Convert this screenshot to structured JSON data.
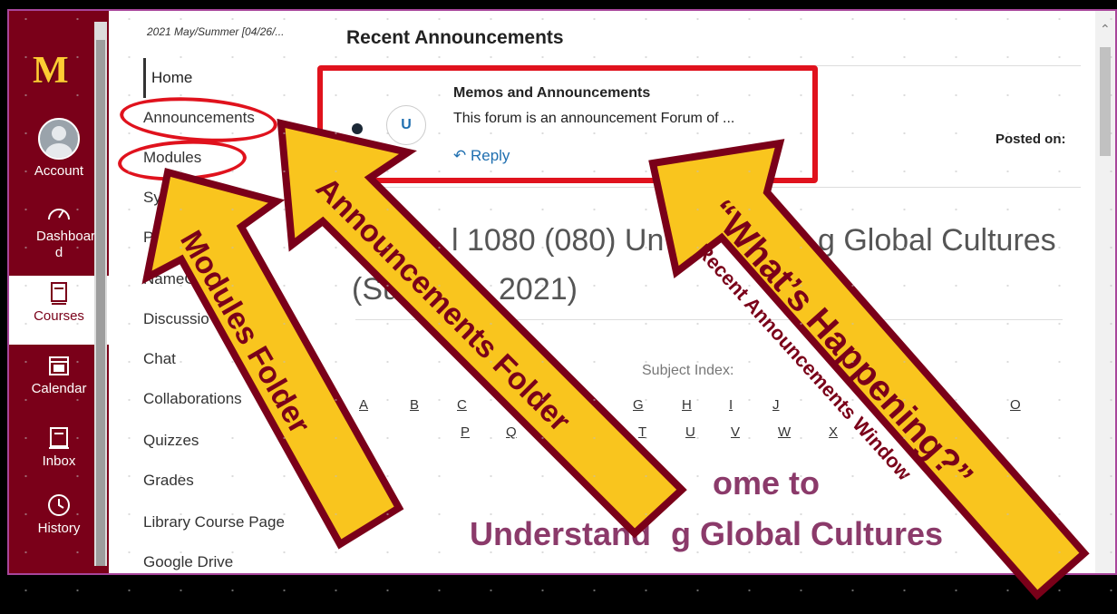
{
  "global_nav": {
    "logo": "M",
    "items": [
      {
        "label": "Account",
        "icon": "account-avatar-icon"
      },
      {
        "label": "Dashboar d",
        "icon": "dashboard-icon"
      },
      {
        "label": "Courses",
        "icon": "courses-icon"
      },
      {
        "label": "Calendar",
        "icon": "calendar-icon"
      },
      {
        "label": "Inbox",
        "icon": "inbox-icon"
      },
      {
        "label": "History",
        "icon": "history-icon"
      }
    ]
  },
  "course_nav": {
    "term": "2021 May/Summer [04/26/...",
    "items": [
      "Home",
      "Announcements",
      "Modules",
      "Sylla",
      "Peo",
      "NameC",
      "Discussio",
      "Chat",
      "Collaborations",
      "Quizzes",
      "Grades",
      "Library Course Page",
      "Google Drive"
    ]
  },
  "recent_announcements": {
    "title": "Recent Announcements",
    "avatar_letter": "U",
    "memo_title": "Memos and Announcements",
    "memo_body": "This forum is an announcement Forum of ...",
    "reply_label": "Reply",
    "posted_label": "Posted on:"
  },
  "course": {
    "title_line1": "l 1080 (080) Un",
    "title_line1b": "g Global Cultures",
    "title_line2": "(Su",
    "title_line2b": "2021)",
    "subject_index_label": "Subject Index:",
    "letters_row1": [
      "A",
      "B",
      "C",
      "G",
      "H",
      "I",
      "J",
      "O"
    ],
    "letters_row2": [
      "P",
      "Q",
      "T",
      "U",
      "V",
      "W",
      "X"
    ],
    "welcome_line1": "ome to",
    "welcome_line2a": "Understand",
    "welcome_line2b": "g Global Cultures"
  },
  "annotations": {
    "modules_label": "Modules Folder",
    "announcements_label": "Announcements Folder",
    "whats_happening": "“What’s Happening?”",
    "recent_window": "Recent Announcements Window"
  },
  "colors": {
    "maroon": "#7a0019",
    "gold": "#ffcc33",
    "arrow_fill": "#f9c51e",
    "highlight_red": "#e0121d"
  }
}
